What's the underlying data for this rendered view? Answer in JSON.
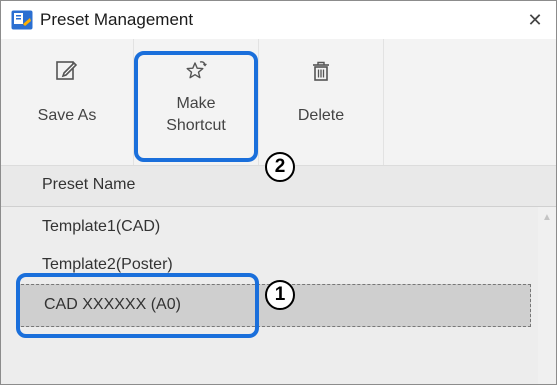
{
  "window": {
    "title": "Preset Management",
    "close_symbol": "✕"
  },
  "toolbar": {
    "save_as_label": "Save As",
    "make_shortcut_label": "Make\nShortcut",
    "delete_label": "Delete"
  },
  "list": {
    "column_header": "Preset Name",
    "rows": [
      {
        "label": "Template1(CAD)",
        "selected": false
      },
      {
        "label": "Template2(Poster)",
        "selected": false
      },
      {
        "label": "CAD XXXXXX (A0)",
        "selected": true
      }
    ]
  },
  "callouts": {
    "one": "1",
    "two": "2"
  },
  "icons": {
    "app": "app-preset-icon",
    "save_as": "save-as-icon",
    "make_shortcut": "star-shortcut-icon",
    "delete": "trash-icon",
    "close": "close-icon",
    "scroll_up": "chevron-up-icon"
  },
  "colors": {
    "highlight": "#1a6fdb",
    "ribbon_bg": "#f3f3f3",
    "list_bg": "#ededed",
    "selected_row": "#cfcfcf"
  }
}
